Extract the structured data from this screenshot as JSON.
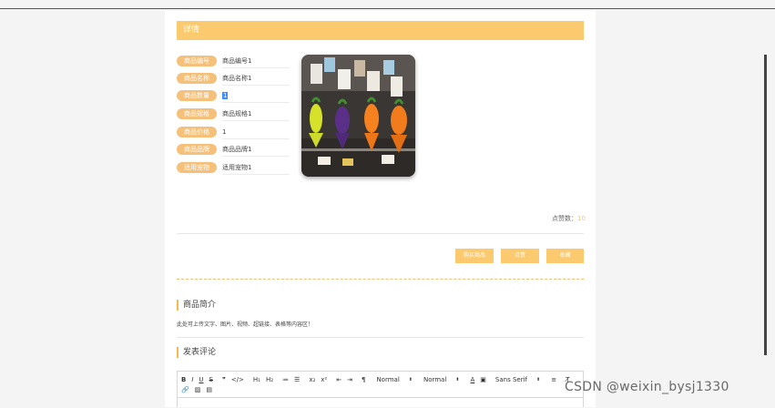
{
  "header": {
    "title": "详情"
  },
  "fields": [
    {
      "label": "商品编号",
      "value": "商品编号1"
    },
    {
      "label": "商品名称",
      "value": "商品名称1"
    },
    {
      "label": "商品数量",
      "value": "1"
    },
    {
      "label": "商品规格",
      "value": "商品规格1"
    },
    {
      "label": "商品价格",
      "value": "1"
    },
    {
      "label": "商品品牌",
      "value": "商品品牌1"
    },
    {
      "label": "适用宠物",
      "value": "适用宠物1"
    }
  ],
  "likes": {
    "label": "点赞数：",
    "value": "10"
  },
  "actions": {
    "buy": "购买商品",
    "like": "点赞",
    "favorite": "收藏"
  },
  "intro": {
    "title": "商品简介",
    "text": "此处可上传文字、图片、视频、超链接、表格等内容区！"
  },
  "comment": {
    "title": "发表评论"
  },
  "editor": {
    "header_select": "Normal",
    "size_select": "Normal",
    "font_select": "Sans Serif"
  },
  "watermark": "CSDN @weixin_bysj1330",
  "colors": {
    "accent": "#fbc96e",
    "label": "#f4c07a",
    "selection": "#3d8bff"
  }
}
